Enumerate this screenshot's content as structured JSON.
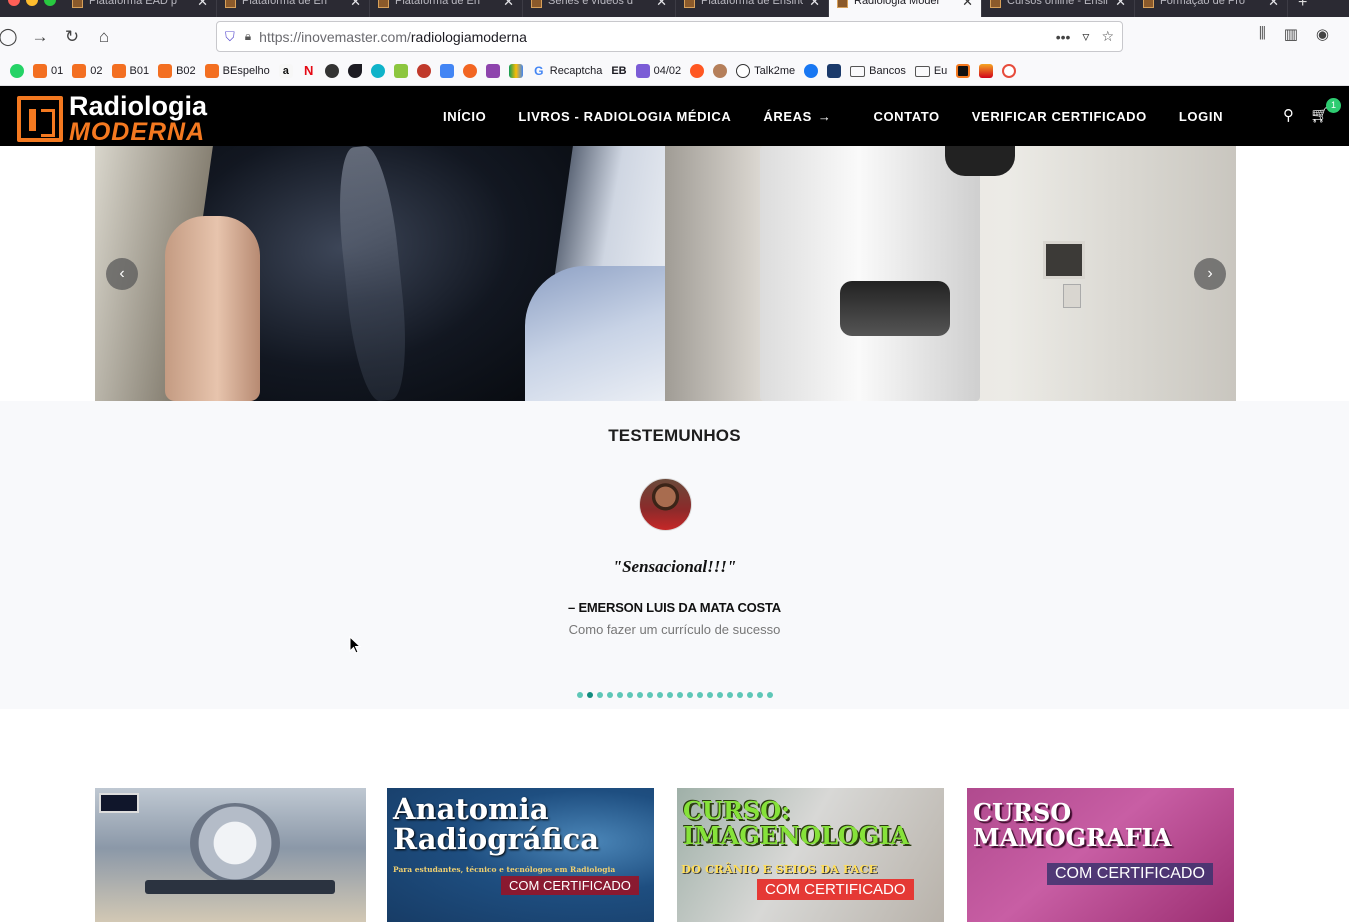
{
  "browser": {
    "tabs": [
      {
        "title": "Plataforma EAD p",
        "active": false
      },
      {
        "title": "Plataforma de En",
        "active": false
      },
      {
        "title": "Plataforma de En",
        "active": false
      },
      {
        "title": "Séries e vídeos d",
        "active": false
      },
      {
        "title": "Plataforma de Ensino",
        "active": false
      },
      {
        "title": "Radiologia Moder",
        "active": true
      },
      {
        "title": "Cursos online - Ensin",
        "active": false
      },
      {
        "title": "Formação de Pro",
        "active": false
      }
    ],
    "url_host": "https://inovemaster.com/",
    "url_path": "radiologiamoderna",
    "bookmarks": [
      "01",
      "02",
      "B01",
      "B02",
      "BEspelho",
      "Recaptcha",
      "EB",
      "04/02",
      "Talk2me",
      "Bancos",
      "Eu"
    ]
  },
  "site": {
    "logo": {
      "line1": "Radiologia",
      "line2": "MODERNA"
    },
    "menu": [
      "INÍCIO",
      "LIVROS - RADIOLOGIA MÉDICA",
      "ÁREAS",
      "CONTATO",
      "VERIFICAR CERTIFICADO",
      "LOGIN"
    ],
    "cart_count": "1",
    "colors": {
      "brand_orange": "#f47920",
      "header_bg": "#000000",
      "dot_active": "#128c7e",
      "dot": "#5ec7b7"
    }
  },
  "testimonials": {
    "heading": "TESTEMUNHOS",
    "quote": "\"Sensacional!!!\"",
    "author": "– EMERSON LUIS DA MATA COSTA",
    "course": "Como fazer um currículo de sucesso",
    "dots_total": 20,
    "dots_active": 2
  },
  "cards": {
    "card2": {
      "title1": "Anatomia",
      "title2": "Radiográfica",
      "sub": "Para estudantes, técnico e tecnólogos em Radiologia",
      "cert": "COM CERTIFICADO"
    },
    "card3": {
      "title1": "CURSO:",
      "title2": "IMAGENOLOGIA",
      "sub": "DO CRÂNIO E SEIOS DA FACE",
      "cert": "COM CERTIFICADO"
    },
    "card4": {
      "title1": "CURSO",
      "title2": "MAMOGRAFIA",
      "cert": "COM CERTIFICADO"
    }
  }
}
